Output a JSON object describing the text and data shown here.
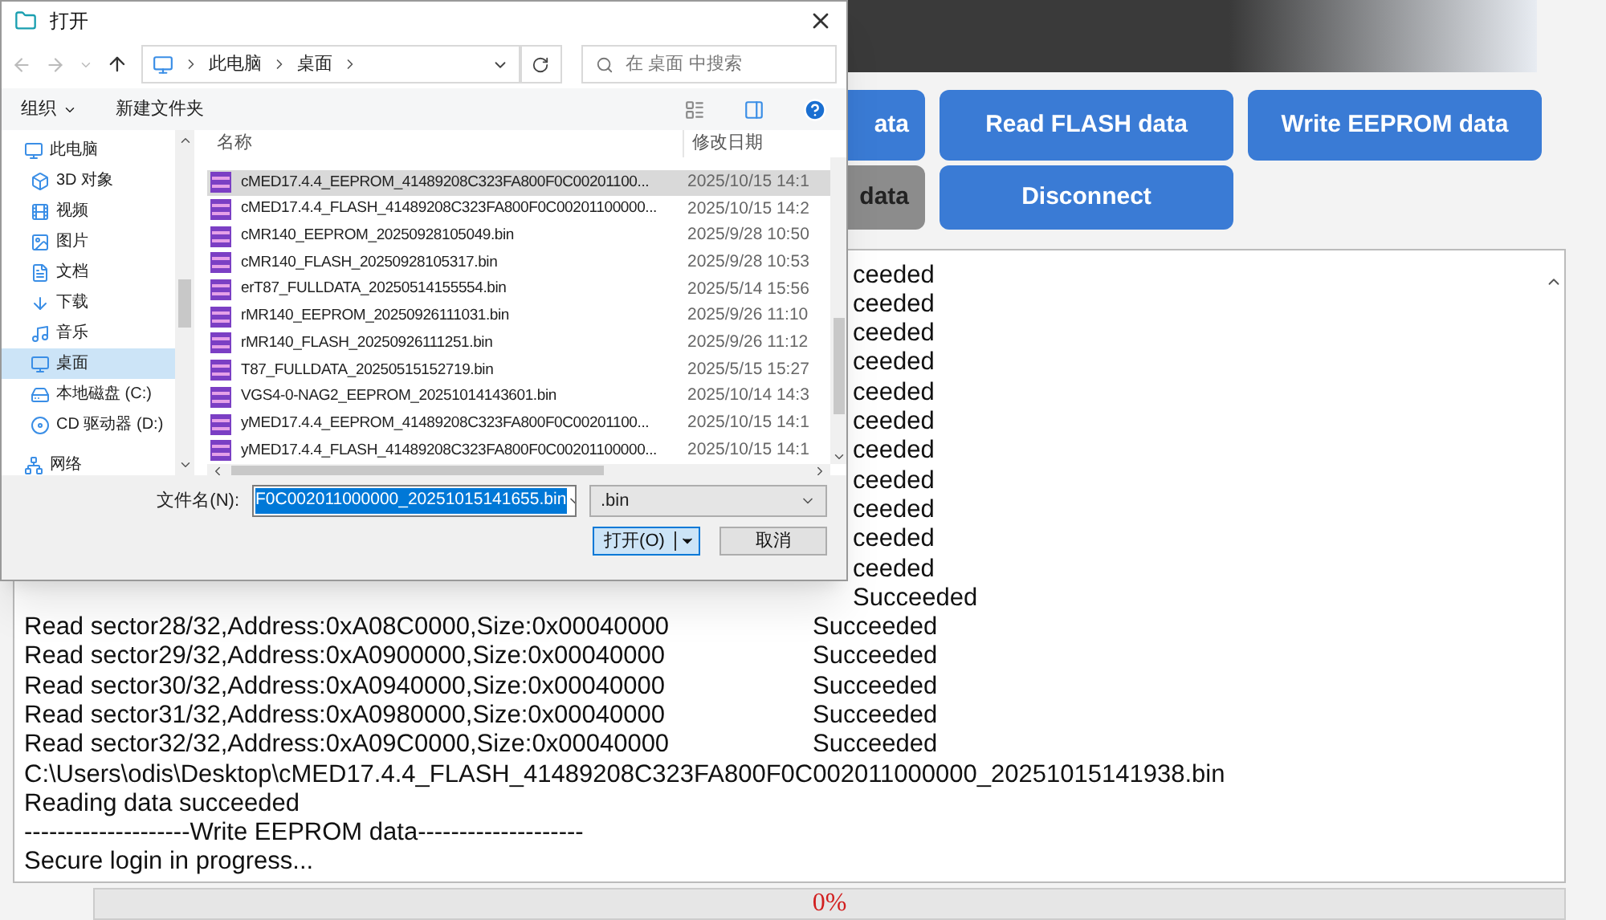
{
  "app": {
    "button_rows": [
      [
        {
          "label": "ata",
          "disabled": false,
          "stub": true
        },
        {
          "label": "Read FLASH data",
          "disabled": false,
          "stub": false
        },
        {
          "label": "Write EEPROM data",
          "disabled": false,
          "stub": false
        }
      ],
      [
        {
          "label": "data",
          "disabled": true,
          "stub": true
        },
        {
          "label": "Disconnect",
          "disabled": false,
          "stub": false
        }
      ]
    ],
    "log": [
      {
        "kind": "sector",
        "status": "ceeded"
      },
      {
        "kind": "sector",
        "status": "ceeded"
      },
      {
        "kind": "sector",
        "status": "ceeded"
      },
      {
        "kind": "sector",
        "status": "ceeded"
      },
      {
        "kind": "sector",
        "status": "ceeded"
      },
      {
        "kind": "sector",
        "status": "ceeded"
      },
      {
        "kind": "sector",
        "status": "ceeded"
      },
      {
        "kind": "sector",
        "status": "ceeded"
      },
      {
        "kind": "sector",
        "status": "ceeded"
      },
      {
        "kind": "sector",
        "status": "ceeded"
      },
      {
        "kind": "sector",
        "status": "ceeded"
      },
      {
        "kind": "sector",
        "status": "Succeeded"
      },
      {
        "kind": "sector",
        "text": "Read sector28/32,Address:0xA08C0000,Size:0x00040000",
        "status": "Succeeded"
      },
      {
        "kind": "sector",
        "text": "Read sector29/32,Address:0xA0900000,Size:0x00040000",
        "status": "Succeeded"
      },
      {
        "kind": "sector",
        "text": "Read sector30/32,Address:0xA0940000,Size:0x00040000",
        "status": "Succeeded"
      },
      {
        "kind": "sector",
        "text": "Read sector31/32,Address:0xA0980000,Size:0x00040000",
        "status": "Succeeded"
      },
      {
        "kind": "sector",
        "text": "Read sector32/32,Address:0xA09C0000,Size:0x00040000",
        "status": "Succeeded"
      },
      {
        "kind": "plain",
        "text": "C:\\Users\\odis\\Desktop\\cMED17.4.4_FLASH_41489208C323FA800F0C002011000000_20251015141938.bin"
      },
      {
        "kind": "plain",
        "text": "Reading data succeeded"
      },
      {
        "kind": "plain",
        "text": "--------------------Write EEPROM data--------------------"
      },
      {
        "kind": "plain",
        "text": "Secure login in progress..."
      }
    ],
    "progress": {
      "level": 0,
      "reading": "0%"
    }
  },
  "dialog": {
    "title": "打开",
    "path": [
      "此电脑",
      "桌面"
    ],
    "search_placeholder": "在 桌面 中搜索",
    "toolbar": {
      "organize": "组织",
      "new_folder": "新建文件夹"
    },
    "sidebar": [
      {
        "label": "此电脑",
        "selected": false,
        "children": [
          {
            "label": "3D 对象",
            "selected": false
          },
          {
            "label": "视频",
            "selected": false
          },
          {
            "label": "图片",
            "selected": false
          },
          {
            "label": "文档",
            "selected": false
          },
          {
            "label": "下载",
            "selected": false
          },
          {
            "label": "音乐",
            "selected": false
          },
          {
            "label": "桌面",
            "selected": true
          },
          {
            "label": "本地磁盘 (C:)",
            "selected": false
          },
          {
            "label": "CD 驱动器 (D:)",
            "selected": false
          }
        ]
      },
      {
        "label": "网络",
        "selected": false
      }
    ],
    "columns": [
      "名称",
      "修改日期"
    ],
    "files": [
      {
        "name": "cMED17.4.4_EEPROM_41489208C323FA800F0C00201100...",
        "date": "2025/10/15 14:1",
        "selected": true
      },
      {
        "name": "cMED17.4.4_FLASH_41489208C323FA800F0C00201100000...",
        "date": "2025/10/15 14:2",
        "selected": false
      },
      {
        "name": "cMR140_EEPROM_20250928105049.bin",
        "date": "2025/9/28 10:50",
        "selected": false
      },
      {
        "name": "cMR140_FLASH_20250928105317.bin",
        "date": "2025/9/28 10:53",
        "selected": false
      },
      {
        "name": "erT87_FULLDATA_20250514155554.bin",
        "date": "2025/5/14 15:56",
        "selected": false
      },
      {
        "name": "rMR140_EEPROM_20250926111031.bin",
        "date": "2025/9/26 11:10",
        "selected": false
      },
      {
        "name": "rMR140_FLASH_20250926111251.bin",
        "date": "2025/9/26 11:12",
        "selected": false
      },
      {
        "name": "T87_FULLDATA_20250515152719.bin",
        "date": "2025/5/15 15:27",
        "selected": false
      },
      {
        "name": "VGS4-0-NAG2_EEPROM_20251014143601.bin",
        "date": "2025/10/14 14:3",
        "selected": false
      },
      {
        "name": "yMED17.4.4_EEPROM_41489208C323FA800F0C00201100...",
        "date": "2025/10/15 14:1",
        "selected": false
      },
      {
        "name": "yMED17.4.4_FLASH_41489208C323FA800F0C00201100000...",
        "date": "2025/10/15 14:1",
        "selected": false
      }
    ],
    "filename_label": "文件名(N):",
    "filename": "F0C002011000000_20251015141655.bin",
    "filetype": ".bin",
    "open": "打开(O)",
    "cancel": "取消"
  }
}
